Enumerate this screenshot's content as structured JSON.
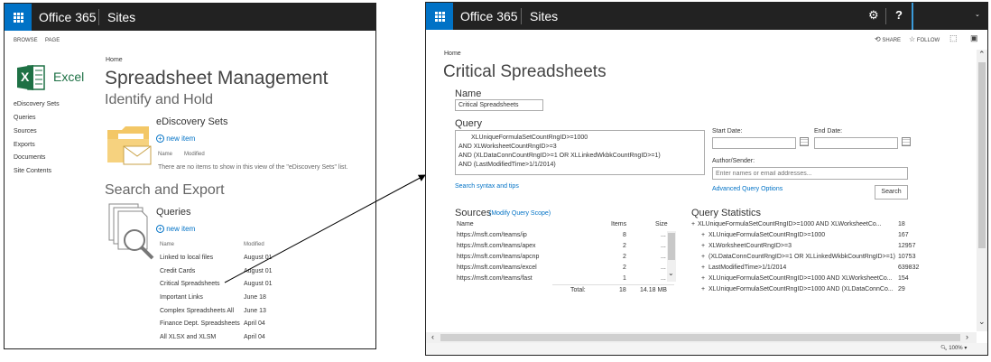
{
  "left": {
    "suite": {
      "brand": "Office 365",
      "app": "Sites"
    },
    "ribbon": {
      "browse": "BROWSE",
      "page": "PAGE"
    },
    "logo": {
      "label": "Excel",
      "glyph": "X"
    },
    "breadcrumb": "Home",
    "site_title": "Spreadsheet Management",
    "nav": [
      "eDiscovery Sets",
      "Queries",
      "Sources",
      "Exports",
      "Documents",
      "Site Contents"
    ],
    "identify_heading": "Identify and Hold",
    "ediscovery": {
      "title": "eDiscovery Sets",
      "new_item": "new item",
      "col_name": "Name",
      "col_modified": "Modified",
      "empty": "There are no items to show in this view of the \"eDiscovery Sets\" list."
    },
    "search_heading": "Search and Export",
    "queries": {
      "title": "Queries",
      "new_item": "new item",
      "col_name": "Name",
      "col_modified": "Modified",
      "rows": [
        {
          "name": "Linked to local files",
          "modified": "August 01"
        },
        {
          "name": "Credit Cards",
          "modified": "August 01"
        },
        {
          "name": "Critical Spreadsheets",
          "modified": "August 01"
        },
        {
          "name": "Important Links",
          "modified": "June 18"
        },
        {
          "name": "Complex Spreadsheets All",
          "modified": "June 13"
        },
        {
          "name": "Finance Dept. Spreadsheets",
          "modified": "April 04"
        },
        {
          "name": "All XLSX and XLSM",
          "modified": "April 04"
        }
      ]
    }
  },
  "right": {
    "suite": {
      "brand": "Office 365",
      "app": "Sites",
      "settings": "⚙",
      "help": "?"
    },
    "actions": {
      "share": "SHARE",
      "follow": "FOLLOW"
    },
    "breadcrumb": "Home",
    "title": "Critical Spreadsheets",
    "name_label": "Name",
    "name_value": "Critical Spreadsheets",
    "query_label": "Query",
    "query_lines": [
      "XLUniqueFormulaSetCountRngID>=1000",
      "AND XLWorksheetCountRngID>=3",
      "AND (XLDataConnCountRngID>=1 OR XLLinkedWkbkCountRngID>=1)",
      "AND (LastModifiedTime>1/1/2014)"
    ],
    "start_date": "Start Date:",
    "end_date": "End Date:",
    "author_label": "Author/Sender:",
    "author_placeholder": "Enter names or email addresses...",
    "syntax_link": "Search syntax and tips",
    "advanced_link": "Advanced Query Options",
    "search_button": "Search",
    "sources": {
      "title": "Sources",
      "modify": "(Modify Query Scope)",
      "col_name": "Name",
      "col_items": "Items",
      "col_size": "Size",
      "rows": [
        {
          "name": "https://msft.com/teams/ip",
          "items": "8",
          "size": "..."
        },
        {
          "name": "https://msft.com/teams/apex",
          "items": "2",
          "size": "..."
        },
        {
          "name": "https://msft.com/teams/apcnp",
          "items": "2",
          "size": "..."
        },
        {
          "name": "https://msft.com/teams/excel",
          "items": "2",
          "size": "..."
        },
        {
          "name": "https://msft.com/teams/fast",
          "items": "1",
          "size": "..."
        }
      ],
      "total_label": "Total:",
      "total_items": "18",
      "total_size": "14.18 MB"
    },
    "stats": {
      "title": "Query Statistics",
      "rows": [
        {
          "label": "XLUniqueFormulaSetCountRngID>=1000 AND XLWorksheetCo...",
          "value": "18"
        },
        {
          "label": "XLUniqueFormulaSetCountRngID>=1000",
          "value": "167"
        },
        {
          "label": "XLWorksheetCountRngID>=3",
          "value": "12957"
        },
        {
          "label": "(XLDataConnCountRngID>=1 OR XLLinkedWkbkCountRngID>=1)",
          "value": "10753"
        },
        {
          "label": "LastModifiedTime>1/1/2014",
          "value": "639832"
        },
        {
          "label": "XLUniqueFormulaSetCountRngID>=1000 AND XLWorksheetCo...",
          "value": "154"
        },
        {
          "label": "XLUniqueFormulaSetCountRngID>=1000 AND (XLDataConnCo...",
          "value": "29"
        }
      ]
    },
    "zoom": "100%"
  },
  "colors": {
    "suite_bar": "#222222",
    "accent": "#0072c6",
    "excel_green": "#1e7145",
    "folder": "#f3c766"
  }
}
